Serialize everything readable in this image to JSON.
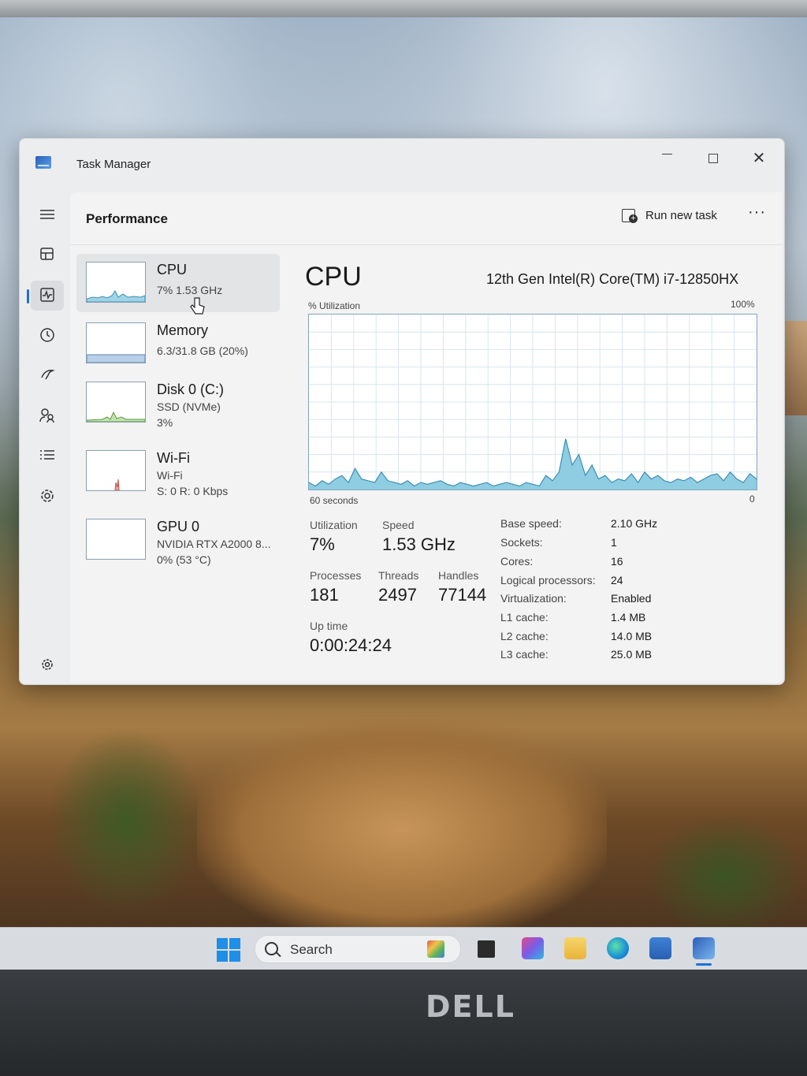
{
  "window": {
    "title": "Task Manager",
    "controls": {
      "minimize": "minimize-icon",
      "maximize": "maximize-icon",
      "close": "✕"
    }
  },
  "rail": {
    "items": [
      "hamburger-menu-icon",
      "processes-icon",
      "performance-icon",
      "app-history-icon",
      "startup-apps-icon",
      "users-icon",
      "details-icon",
      "services-icon",
      "settings-icon"
    ],
    "active": "performance-icon"
  },
  "header": {
    "title": "Performance",
    "run_new_task": "Run new task",
    "more": "···"
  },
  "devices": [
    {
      "name": "CPU",
      "line1": "7%  1.53 GHz",
      "line2": ""
    },
    {
      "name": "Memory",
      "line1": "6.3/31.8 GB (20%)",
      "line2": ""
    },
    {
      "name": "Disk 0 (C:)",
      "line1": "SSD (NVMe)",
      "line2": "3%"
    },
    {
      "name": "Wi-Fi",
      "line1": "Wi-Fi",
      "line2": "S: 0  R: 0 Kbps"
    },
    {
      "name": "GPU 0",
      "line1": "NVIDIA RTX A2000 8...",
      "line2": "0%  (53 °C)"
    }
  ],
  "cpu": {
    "title": "CPU",
    "model": "12th Gen Intel(R) Core(TM) i7-12850HX",
    "graph": {
      "y_label": "% Utilization",
      "y_max_label": "100%",
      "x_left_label": "60 seconds",
      "x_right_label": "0",
      "utilization_series": [
        4,
        2,
        5,
        3,
        6,
        8,
        4,
        12,
        6,
        5,
        4,
        10,
        5,
        4,
        3,
        5,
        2,
        4,
        3,
        4,
        5,
        3,
        2,
        4,
        3,
        2,
        3,
        4,
        2,
        3,
        4,
        3,
        2,
        4,
        3,
        2,
        8,
        5,
        10,
        29,
        14,
        20,
        8,
        14,
        6,
        8,
        4,
        6,
        5,
        9,
        4,
        10,
        6,
        8,
        5,
        4,
        6,
        5,
        7,
        4,
        6,
        8,
        9,
        5,
        10,
        6,
        4,
        9,
        6
      ]
    },
    "stats": {
      "utilization_label": "Utilization",
      "utilization": "7%",
      "speed_label": "Speed",
      "speed": "1.53 GHz",
      "processes_label": "Processes",
      "processes": "181",
      "threads_label": "Threads",
      "threads": "2497",
      "handles_label": "Handles",
      "handles": "77144",
      "uptime_label": "Up time",
      "uptime": "0:00:24:24"
    },
    "specs": [
      {
        "key": "Base speed:",
        "value": "2.10 GHz"
      },
      {
        "key": "Sockets:",
        "value": "1"
      },
      {
        "key": "Cores:",
        "value": "16"
      },
      {
        "key": "Logical processors:",
        "value": "24"
      },
      {
        "key": "Virtualization:",
        "value": "Enabled"
      },
      {
        "key": "L1 cache:",
        "value": "1.4 MB"
      },
      {
        "key": "L2 cache:",
        "value": "14.0 MB"
      },
      {
        "key": "L3 cache:",
        "value": "25.0 MB"
      }
    ]
  },
  "taskbar": {
    "search_label": "Search",
    "apps": [
      "start-icon",
      "search-highlight-icon",
      "file-explorer-app-icon",
      "microsoft-365-icon",
      "folder-icon",
      "edge-icon",
      "store-icon",
      "task-manager-icon"
    ]
  },
  "laptop": {
    "brand": "DELL"
  },
  "colors": {
    "accent": "#1e6fd6",
    "graph_fill": "#8fcde2",
    "graph_line": "#3a8fb7",
    "graph_grid": "#d7e6ee"
  }
}
